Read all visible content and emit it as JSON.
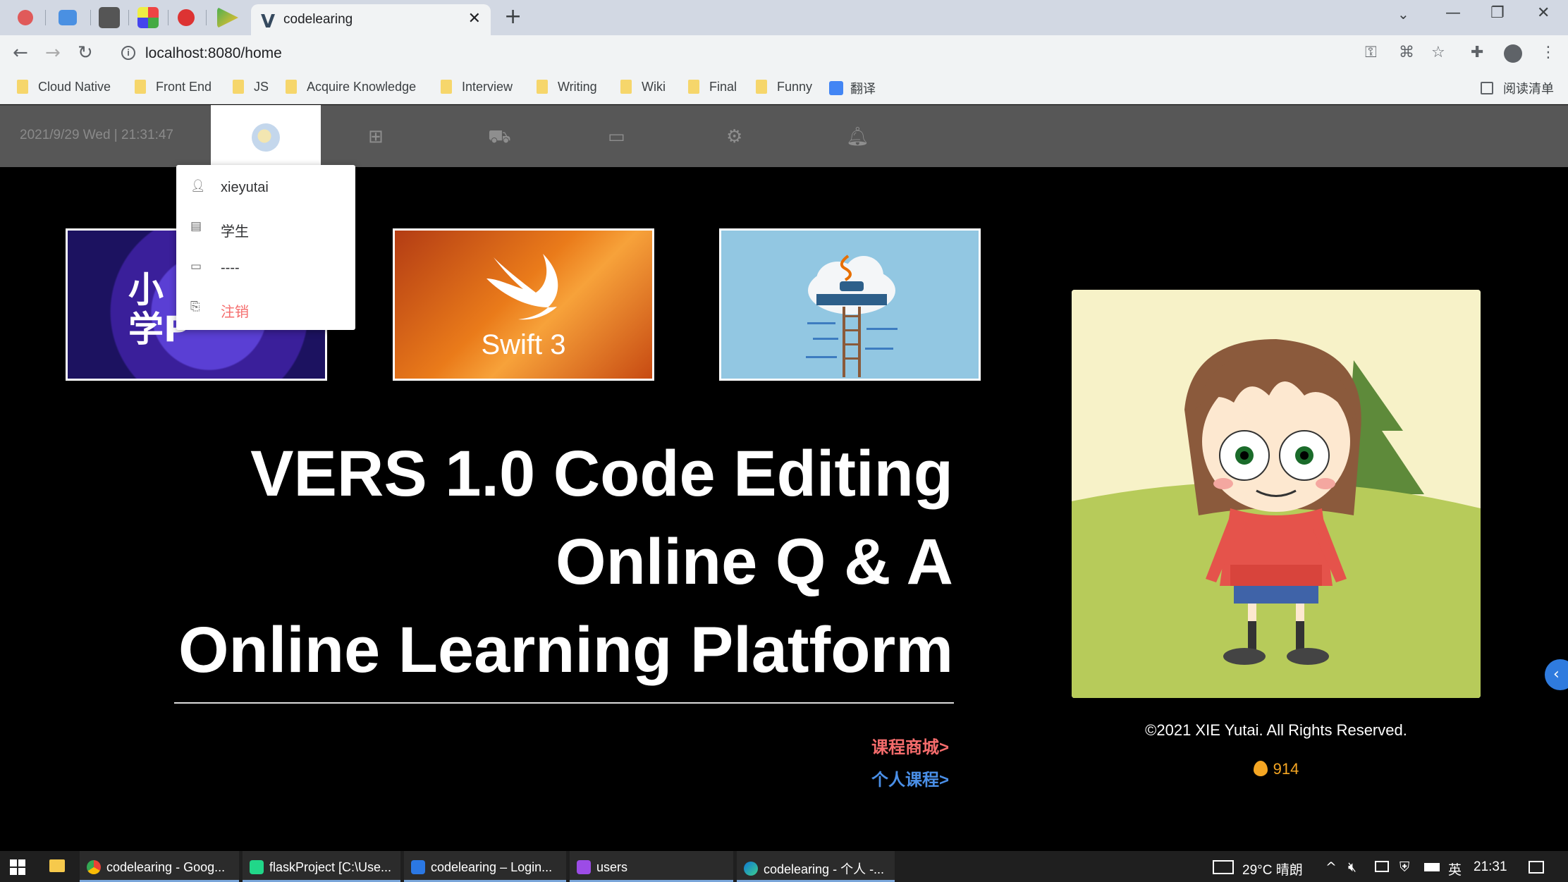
{
  "browser": {
    "active_tab_title": "codelearing",
    "url": "localhost:8080/home",
    "bookmarks": [
      "Cloud Native",
      "Front End",
      "JS",
      "Acquire Knowledge",
      "Interview",
      "Writing",
      "Wiki",
      "Final",
      "Funny",
      "翻译"
    ],
    "reading_list": "阅读清单"
  },
  "header": {
    "datetime": "2021/9/29 Wed | 21:31:47"
  },
  "user_menu": {
    "items": [
      {
        "icon": "user-icon",
        "label": "xieyutai"
      },
      {
        "icon": "id-card-icon",
        "label": "学生"
      },
      {
        "icon": "credit-card-icon",
        "label": "----"
      },
      {
        "icon": "logout-icon",
        "label": "注销"
      }
    ]
  },
  "courses": [
    {
      "label": "小\n学P"
    },
    {
      "label": "Swift 3"
    },
    {
      "label": ""
    }
  ],
  "hero": {
    "line1": "VERS 1.0 Code Editing",
    "line2": "Online Q & A",
    "line3": "Online Learning Platform",
    "link_store": "课程商城>",
    "link_personal": "个人课程>"
  },
  "footer": {
    "copyright": "©2021 XIE Yutai. All Rights Reserved.",
    "score": "914"
  },
  "taskbar": {
    "items": [
      "codelearing - Goog...",
      "flaskProject [C:\\Use...",
      "codelearing – Login...",
      "users",
      "codelearing - 个人 -..."
    ],
    "weather": "29°C 晴朗",
    "ime": "英",
    "clock": "21:31"
  },
  "colors": {
    "header_bg": "#575757",
    "danger": "#f56c6c",
    "link_store": "#f56c6c",
    "link_personal": "#4a8fe7",
    "score": "#f5a623"
  }
}
